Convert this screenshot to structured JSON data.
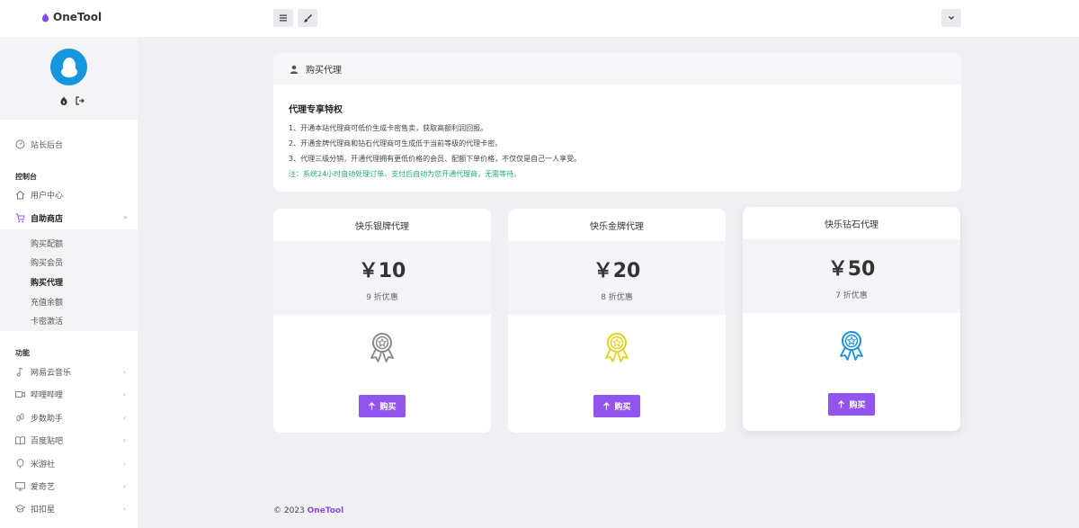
{
  "header": {
    "brand": "OneTool",
    "menu_icon": "hamburger-icon",
    "theme_icon": "brush-icon",
    "dropdown_icon": "chevron-down-icon"
  },
  "sidebar": {
    "profile_icons": [
      "fire-icon",
      "logout-icon"
    ],
    "dashboard": "站长后台",
    "section_console": "控制台",
    "user_center": "用户中心",
    "shop": "自助商店",
    "shop_items": [
      "购买配额",
      "购买会员",
      "购买代理",
      "充值余额",
      "卡密激活"
    ],
    "active_shop_item": "购买代理",
    "section_features": "功能",
    "features": [
      "网易云音乐",
      "哔哩哔哩",
      "步数助手",
      "百度贴吧",
      "米游社",
      "爱奇艺",
      "扣扣星"
    ]
  },
  "info": {
    "header": "购买代理",
    "title": "代理专享特权",
    "lines": [
      "1、开通本站代理商可低价生成卡密售卖，获取高额利润回报。",
      "2、开通金牌代理商和钻石代理商可生成低于当前等级的代理卡密。",
      "3、代理三级分销，开通代理拥有更低价格的会员、配额下单价格，不仅仅是自己一人享受。"
    ],
    "note": "注：系统24小时自动处理订单，支付后自动为您开通代理商，无需等待。"
  },
  "plans": [
    {
      "name": "快乐银牌代理",
      "price": "￥10",
      "discount": "9 折优惠",
      "button": "购买",
      "color": "#888888"
    },
    {
      "name": "快乐金牌代理",
      "price": "￥20",
      "discount": "8 折优惠",
      "button": "购买",
      "color": "#e6d21a"
    },
    {
      "name": "快乐钻石代理",
      "price": "￥50",
      "discount": "7 折优惠",
      "button": "购买",
      "color": "#1b8fd8"
    }
  ],
  "footer": {
    "copyright": "© 2023",
    "brand": "OneTool"
  },
  "colors": {
    "accent": "#9155ee",
    "note": "#1faa7c",
    "avatar": "#1796e0"
  }
}
